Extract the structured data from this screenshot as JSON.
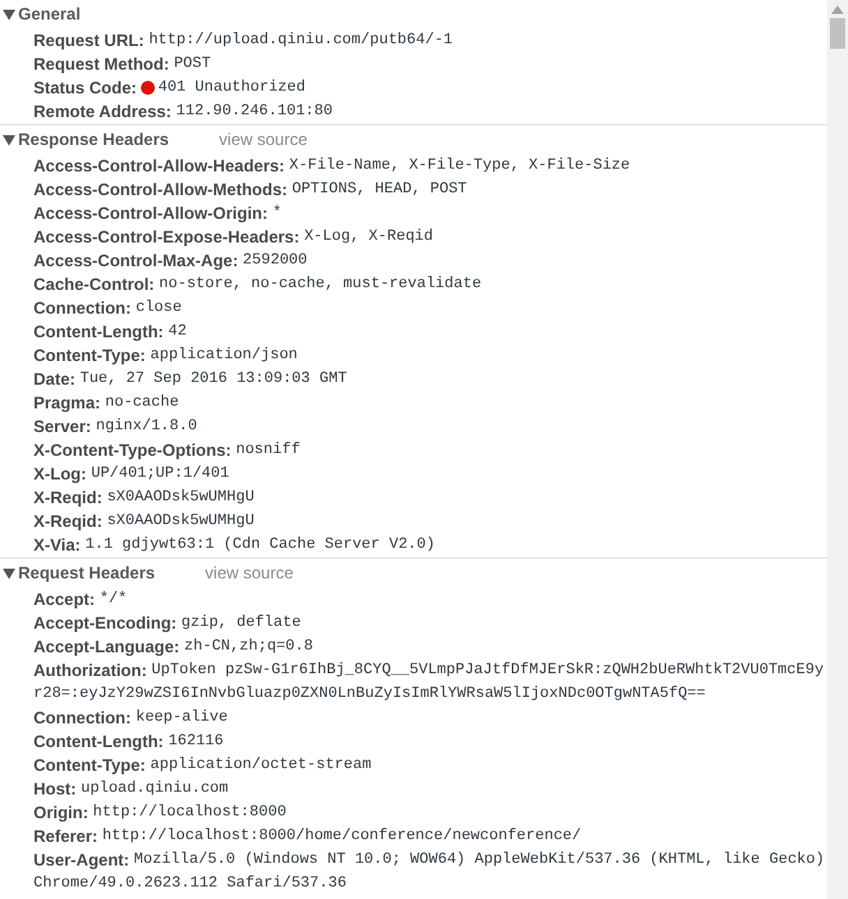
{
  "sections": [
    {
      "title": "General",
      "expanded": true,
      "headers": [
        {
          "name": "Request URL:",
          "value": "http://upload.qiniu.com/putb64/-1"
        },
        {
          "name": "Request Method:",
          "value": "POST"
        },
        {
          "name": "Status Code:",
          "value": "401 Unauthorized",
          "kind": "status"
        },
        {
          "name": "Remote Address:",
          "value": "112.90.246.101:80"
        }
      ]
    },
    {
      "title": "Response Headers",
      "link": "view source",
      "expanded": true,
      "headers": [
        {
          "name": "Access-Control-Allow-Headers:",
          "value": "X-File-Name, X-File-Type, X-File-Size"
        },
        {
          "name": "Access-Control-Allow-Methods:",
          "value": "OPTIONS, HEAD, POST"
        },
        {
          "name": "Access-Control-Allow-Origin:",
          "value": "*"
        },
        {
          "name": "Access-Control-Expose-Headers:",
          "value": "X-Log, X-Reqid"
        },
        {
          "name": "Access-Control-Max-Age:",
          "value": "2592000"
        },
        {
          "name": "Cache-Control:",
          "value": "no-store, no-cache, must-revalidate"
        },
        {
          "name": "Connection:",
          "value": "close"
        },
        {
          "name": "Content-Length:",
          "value": "42"
        },
        {
          "name": "Content-Type:",
          "value": "application/json"
        },
        {
          "name": "Date:",
          "value": "Tue, 27 Sep 2016 13:09:03 GMT"
        },
        {
          "name": "Pragma:",
          "value": "no-cache"
        },
        {
          "name": "Server:",
          "value": "nginx/1.8.0"
        },
        {
          "name": "X-Content-Type-Options:",
          "value": "nosniff"
        },
        {
          "name": "X-Log:",
          "value": "UP/401;UP:1/401"
        },
        {
          "name": "X-Reqid:",
          "value": "sX0AAODsk5wUMHgU"
        },
        {
          "name": "X-Reqid:",
          "value": "sX0AAODsk5wUMHgU"
        },
        {
          "name": "X-Via:",
          "value": "1.1 gdjywt63:1 (Cdn Cache Server V2.0)"
        }
      ]
    },
    {
      "title": "Request Headers",
      "link": "view source",
      "expanded": true,
      "headers": [
        {
          "name": "Accept:",
          "value": "*/*"
        },
        {
          "name": "Accept-Encoding:",
          "value": "gzip, deflate"
        },
        {
          "name": "Accept-Language:",
          "value": "zh-CN,zh;q=0.8"
        },
        {
          "name": "Authorization:",
          "value": "UpToken pzSw-G1r6IhBj_8CYQ__5VLmpPJaJtfDfMJErSkR:zQWH2bUeRWhtkT2VU0TmcE9yr28=:eyJzY29wZSI6InNvbGluazp0ZXN0LnBuZyIsImRlYWRsaW5lIjoxNDc0OTgwNTA5fQ=="
        },
        {
          "name": "Connection:",
          "value": "keep-alive"
        },
        {
          "name": "Content-Length:",
          "value": "162116"
        },
        {
          "name": "Content-Type:",
          "value": "application/octet-stream"
        },
        {
          "name": "Host:",
          "value": "upload.qiniu.com"
        },
        {
          "name": "Origin:",
          "value": "http://localhost:8000"
        },
        {
          "name": "Referer:",
          "value": "http://localhost:8000/home/conference/newconference/"
        },
        {
          "name": "User-Agent:",
          "value": "Mozilla/5.0 (Windows NT 10.0; WOW64) AppleWebKit/537.36 (KHTML, like Gecko) Chrome/49.0.2623.112 Safari/537.36"
        }
      ]
    }
  ]
}
